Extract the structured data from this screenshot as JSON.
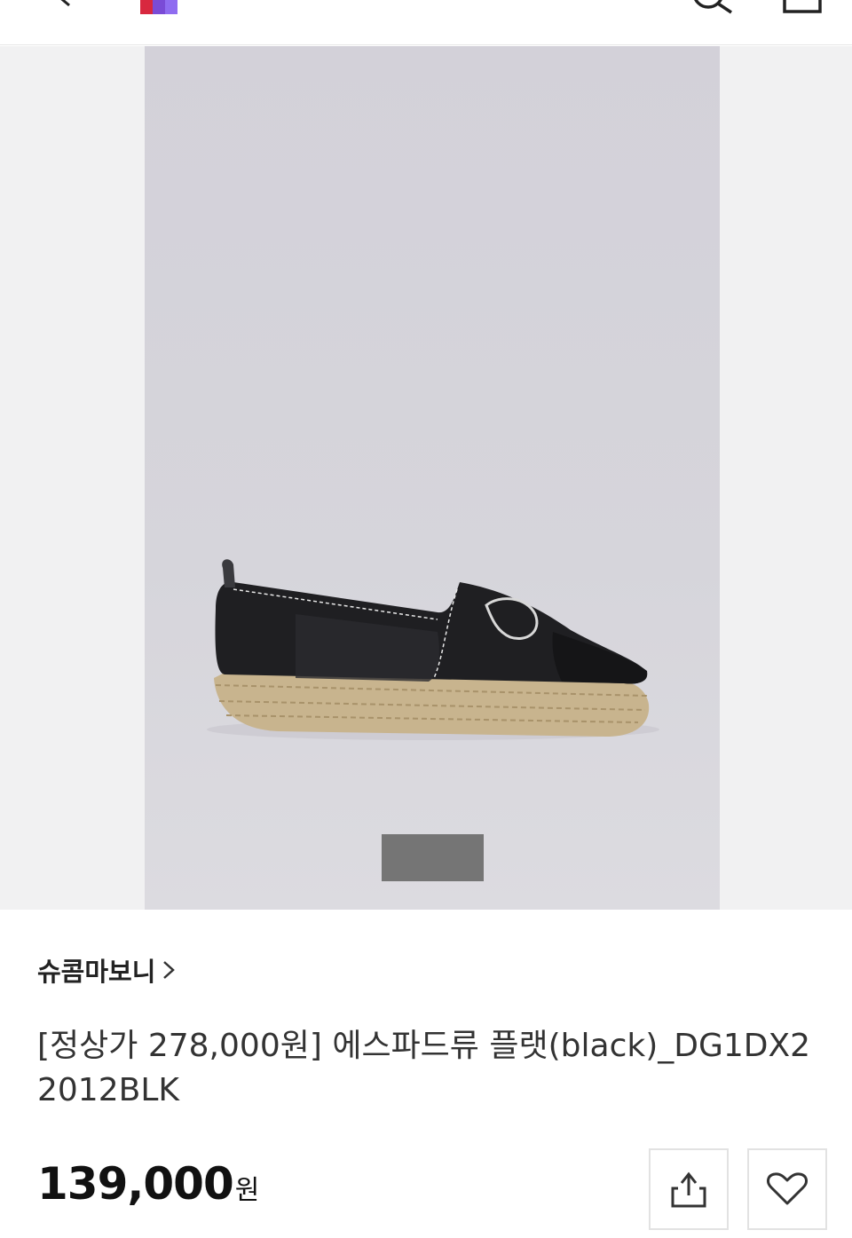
{
  "header": {
    "back_icon": "chevron-left-icon",
    "logo_icon": "brand-logo",
    "search_icon": "search-icon",
    "cart_icon": "cart-icon"
  },
  "gallery": {
    "image": "black-mesh-espadrille-flat-photo",
    "indicator_color": "#757575"
  },
  "product": {
    "brand": "슈콤마보니",
    "brand_chevron": "chevron-right-icon",
    "title": "[정상가 278,000원] 에스파드류 플랫(black)_DG1DX22012BLK",
    "price": "139,000",
    "currency": "원"
  },
  "actions": {
    "share_icon": "share-icon",
    "like_icon": "heart-icon"
  }
}
